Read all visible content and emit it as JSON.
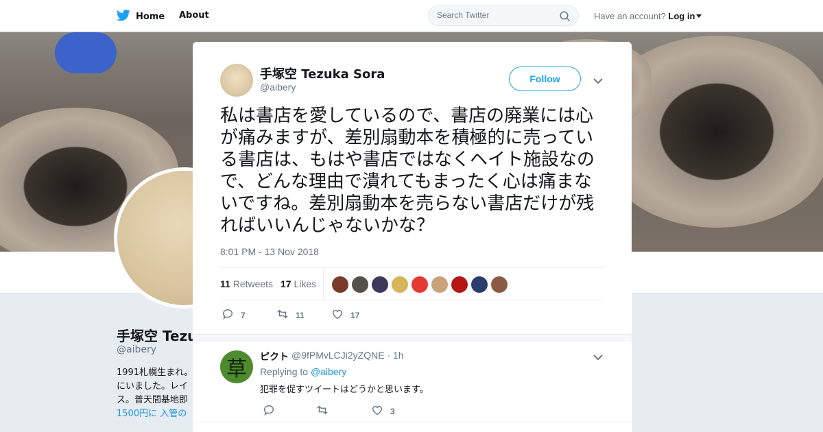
{
  "nav": {
    "home_label": "Home",
    "about_label": "About",
    "search_placeholder": "Search Twitter",
    "account_prompt": "Have an account?",
    "login_label": "Log in"
  },
  "background_profile": {
    "name": "手塚空 Tezu",
    "handle": "@aibery",
    "bio_lines": [
      "1991札幌生まれ。",
      "にいました。レイ",
      "ス。普天間基地即",
      "1500円に 入管の"
    ]
  },
  "tweet": {
    "author_name": "手塚空 Tezuka Sora",
    "author_handle": "@aibery",
    "follow_label": "Follow",
    "text": "私は書店を愛しているので、書店の廃業には心が痛みますが、差別扇動本を積極的に売っている書店は、もはや書店ではなくヘイト施設なので、どんな理由で潰れてもまったく心は痛まないですね。差別扇動本を売らない書店だけが残ればいいんじゃないかな？",
    "timestamp": "8:01 PM - 13 Nov 2018",
    "retweet_count": "11",
    "retweet_label": "Retweets",
    "like_count": "17",
    "like_label": "Likes",
    "reply_action_count": "7",
    "retweet_action_count": "11",
    "like_action_count": "17"
  },
  "likers": [
    {
      "color": "#7a3b2a"
    },
    {
      "color": "#55504a"
    },
    {
      "color": "#3b3a5c"
    },
    {
      "color": "#d7b35a"
    },
    {
      "color": "#e53935"
    },
    {
      "color": "#c9a27a"
    },
    {
      "color": "#b51717"
    },
    {
      "color": "#2c3e70"
    },
    {
      "color": "#8a5a44"
    }
  ],
  "reply": {
    "avatar_char": "草",
    "name": "ピクト",
    "handle": "@9fPMvLCJi2yZQNE",
    "time": "· 1h",
    "replying_prefix": "Replying to",
    "replying_to": "@aibery",
    "text": "犯罪を促すツイートはどうかと思います。",
    "like_count": "3"
  },
  "colors": {
    "accent": "#1da1f2",
    "link": "#1b95e0",
    "muted": "#657786"
  }
}
